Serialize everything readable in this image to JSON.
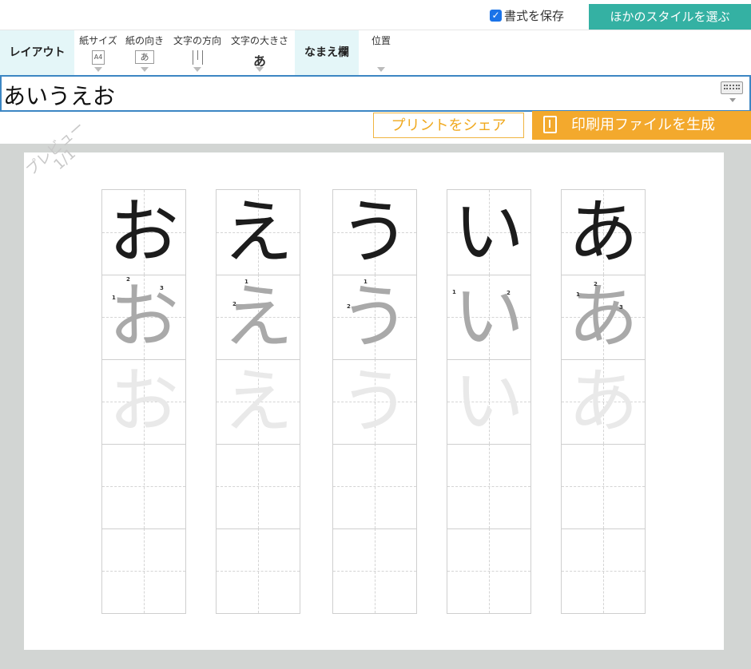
{
  "header": {
    "save_format_label": "書式を保存",
    "save_format_checked": true,
    "choose_style_label": "ほかのスタイルを選ぶ"
  },
  "toolbar": {
    "layout_label": "レイアウト",
    "paper_size": {
      "label": "紙サイズ",
      "value": "A4"
    },
    "orientation": {
      "label": "紙の向き",
      "value": "あ"
    },
    "text_direction": {
      "label": "文字の方向"
    },
    "text_size": {
      "label": "文字の大きさ",
      "value": "あ"
    },
    "name_field_label": "なまえ欄",
    "position": {
      "label": "位置"
    }
  },
  "input": {
    "value": "あいうえお",
    "keyboard_icon": "keyboard-icon"
  },
  "actions": {
    "share_label": "プリントをシェア",
    "generate_label": "印刷用ファイルを生成",
    "generate_icon": "file-download-icon"
  },
  "preview": {
    "watermark_line1": "プレビュー",
    "watermark_line2": "1/1",
    "columns": [
      {
        "char": "お",
        "strokes": [
          "1",
          "2",
          "3"
        ]
      },
      {
        "char": "え",
        "strokes": [
          "1",
          "2"
        ]
      },
      {
        "char": "う",
        "strokes": [
          "1",
          "2"
        ]
      },
      {
        "char": "い",
        "strokes": [
          "1",
          "2"
        ]
      },
      {
        "char": "あ",
        "strokes": [
          "1",
          "2",
          "3"
        ]
      }
    ]
  },
  "colors": {
    "accent_teal": "#34b1a3",
    "toolbar_highlight": "#e4f6f8",
    "input_border": "#3c86c3",
    "share_orange": "#f0a91f",
    "generate_orange": "#f3a92d",
    "preview_bg": "#d2d5d3"
  }
}
